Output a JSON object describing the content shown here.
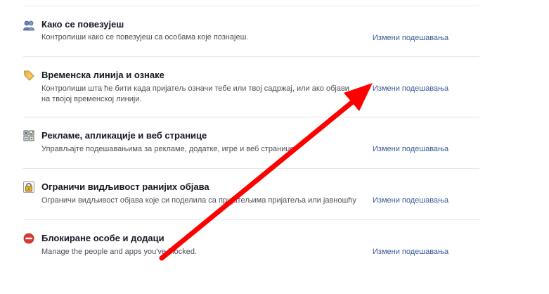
{
  "rows": [
    {
      "title": "Како се повезујеш",
      "desc": "Контролиши како се повезујеш са особама које познајеш.",
      "edit": "Измени подешавања",
      "icon": "people-icon"
    },
    {
      "title": "Временска линија и ознаке",
      "desc": "Контролиши шта ће бити када пријатељ означи тебе или твој садржај, или ако објави на твојој временској линији.",
      "edit": "Измени подешавања",
      "icon": "tag-icon"
    },
    {
      "title": "Рекламе, апликације и веб странице",
      "desc": "Управљајте подешавањима за рекламе, додатке, игре и веб странице.",
      "edit": "Измени подешавања",
      "icon": "apps-icon"
    },
    {
      "title": "Ограничи видљивост ранијих објава",
      "desc": "Ограничи видљивост објава које си поделила са пријатељима пријатеља или јавношћу",
      "edit": "Измени подешавања",
      "icon": "lock-icon"
    },
    {
      "title": "Блокиране особе и додаци",
      "desc": "Manage the people and apps you've blocked.",
      "edit": "Измени подешавања",
      "icon": "block-icon"
    }
  ],
  "colors": {
    "link": "#3b5998",
    "arrow": "#ff0000"
  }
}
